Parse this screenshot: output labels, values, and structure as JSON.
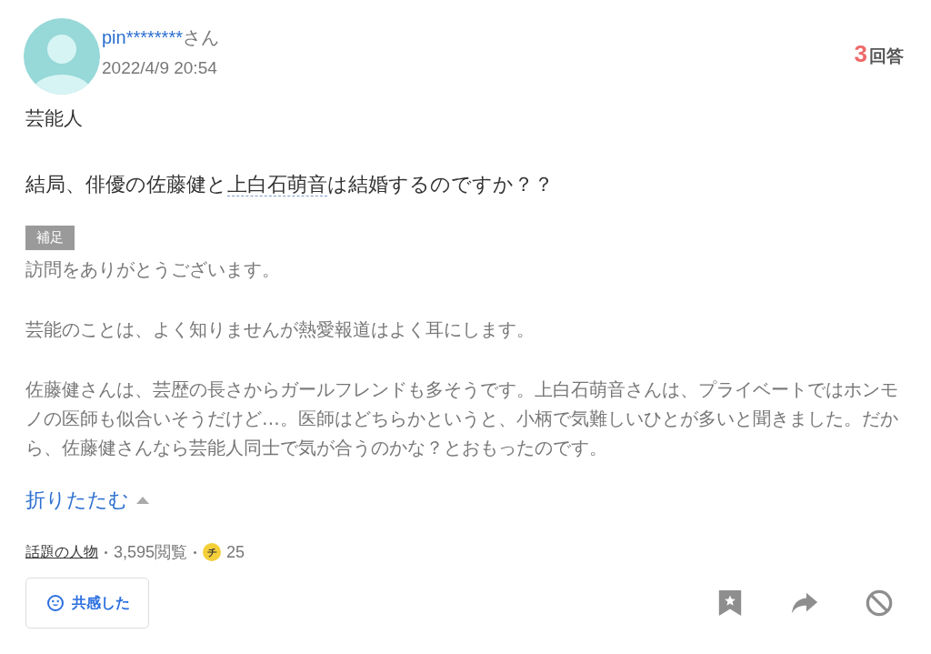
{
  "author": {
    "name": "pin********",
    "suffix": "さん",
    "date": "2022/4/9 20:54"
  },
  "answers": {
    "count": "3",
    "label": "回答"
  },
  "category": "芸能人",
  "question": {
    "before": "結局、俳優の佐藤健と",
    "link": "上白石萌音",
    "after": "は結婚するのですか？？"
  },
  "supplement": {
    "label": "補足",
    "expanded": true,
    "paragraphs": [
      "訪問をありがとうございます。",
      "芸能のことは、よく知りませんが熱愛報道はよく耳にします。",
      "佐藤健さんは、芸歴の長さからガールフレンドも多そうです。上白石萌音さんは、プライベートではホンモノの医師も似合いそうだけど…。医師はどちらかというと、小柄で気難しいひとが多いと聞きました。だから、佐藤健さんなら芸能人同士で気が合うのかな？とおもったのです。"
    ]
  },
  "toggle": "折りたたむ",
  "meta": {
    "tag": "話題の人物",
    "views": "3,595閲覧",
    "coin": "チ",
    "coins": "25"
  },
  "empathy_button": "共感した"
}
